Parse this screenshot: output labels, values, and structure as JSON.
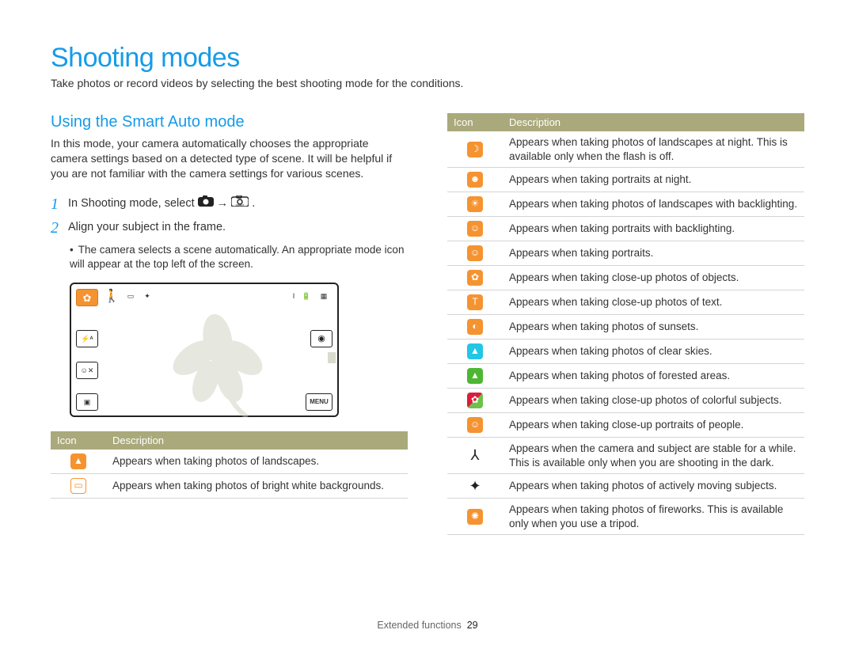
{
  "title": "Shooting modes",
  "intro": "Take photos or record videos by selecting the best shooting mode for the conditions.",
  "left": {
    "subhead": "Using the Smart Auto mode",
    "para": "In this mode, your camera automatically chooses the appropriate camera settings based on a detected type of scene. It will be helpful if you are not familiar with the camera settings for various scenes.",
    "step1_a": "In Shooting mode, select ",
    "step1_arrow": "→",
    "step1_b": ".",
    "step2": "Align your subject in the frame.",
    "step2_sub": "The camera selects a scene automatically. An appropriate mode icon will appear at the top left of the screen.",
    "table_header_icon": "Icon",
    "table_header_desc": "Description",
    "rows": [
      {
        "desc": "Appears when taking photos of landscapes."
      },
      {
        "desc": "Appears when taking photos of bright white backgrounds."
      }
    ]
  },
  "right": {
    "table_header_icon": "Icon",
    "table_header_desc": "Description",
    "rows": [
      {
        "desc": "Appears when taking photos of landscapes at night. This is available only when the flash is off."
      },
      {
        "desc": "Appears when taking portraits at night."
      },
      {
        "desc": "Appears when taking photos of landscapes with backlighting."
      },
      {
        "desc": "Appears when taking portraits with backlighting."
      },
      {
        "desc": "Appears when taking portraits."
      },
      {
        "desc": "Appears when taking close-up photos of objects."
      },
      {
        "desc": "Appears when taking close-up photos of text."
      },
      {
        "desc": "Appears when taking photos of sunsets."
      },
      {
        "desc": "Appears when taking photos of clear skies."
      },
      {
        "desc": "Appears when taking photos of forested areas."
      },
      {
        "desc": "Appears when taking close-up photos of colorful subjects."
      },
      {
        "desc": "Appears when taking close-up portraits of people."
      },
      {
        "desc": "Appears when the camera and subject are stable for a while. This is available only when you are shooting in the dark."
      },
      {
        "desc": "Appears when taking photos of actively moving subjects."
      },
      {
        "desc": "Appears when taking photos of fireworks. This is available only when you use a tripod."
      }
    ]
  },
  "footer_label": "Extended functions",
  "footer_page": "29"
}
